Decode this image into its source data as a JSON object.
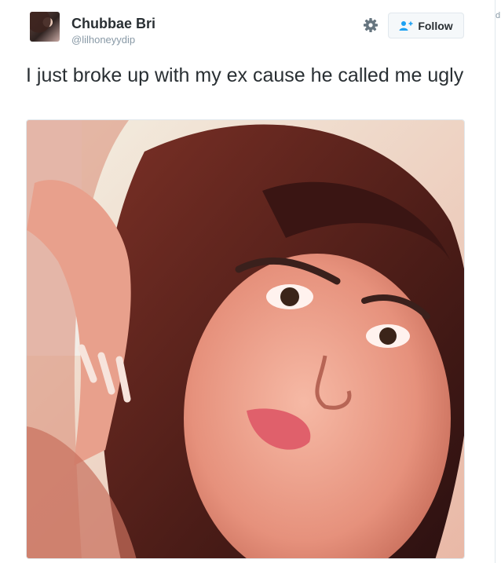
{
  "user": {
    "display_name": "Chubbae Bri",
    "handle": "@lilhoneyydip",
    "avatar_icon": "profile-photo"
  },
  "actions": {
    "settings_icon": "gear-icon",
    "follow_label": "Follow",
    "follow_icon": "follow-person-plus-icon",
    "follow_color": "#1da1f2"
  },
  "tweet": {
    "text": "I just broke up with my ex cause he called me ugly",
    "media_icon": "selfie-photo"
  },
  "edge": {
    "char": "d"
  }
}
